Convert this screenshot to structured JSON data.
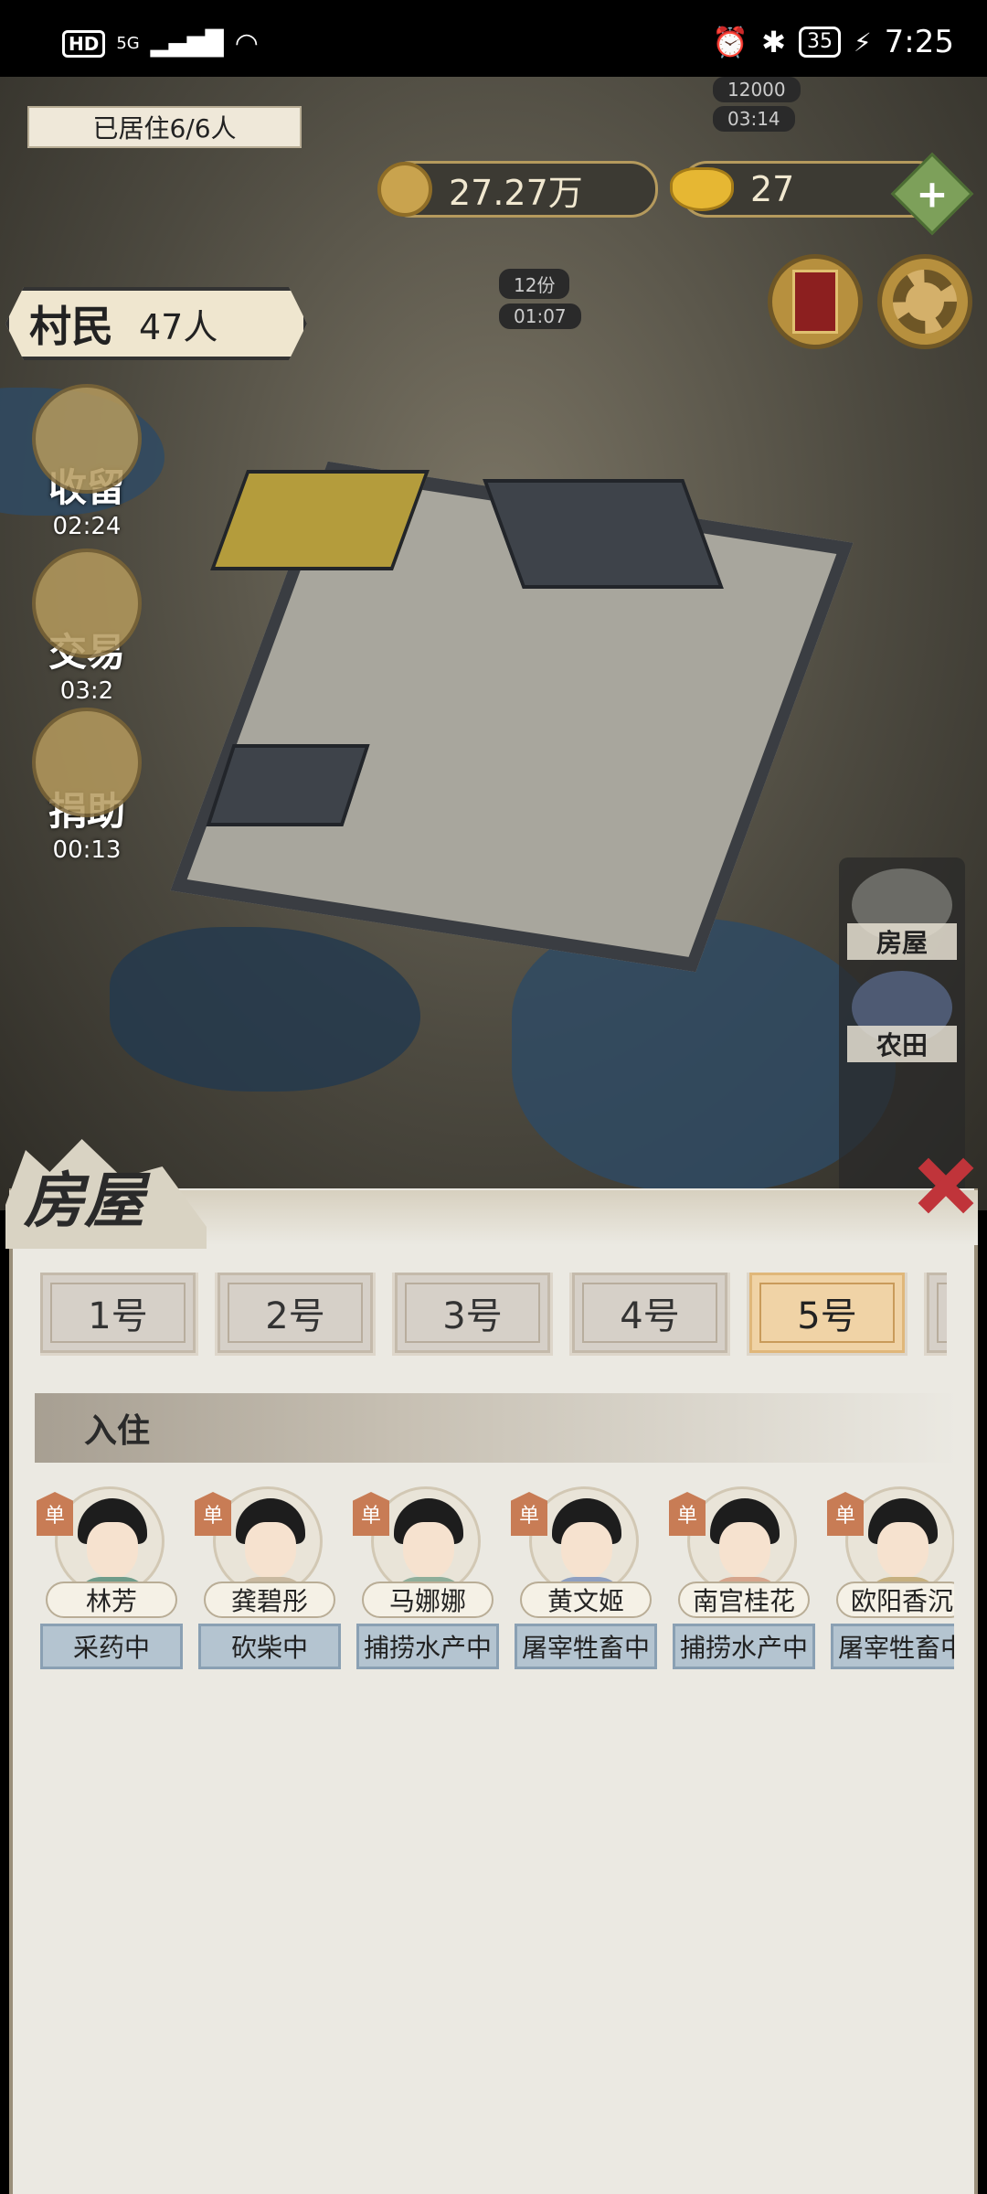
{
  "status_bar": {
    "hd": "HD",
    "network": "5G",
    "battery": "35",
    "time": "7:25"
  },
  "hud": {
    "occupancy": "已居住6/6人",
    "coins": "27.27万",
    "ingots": "27",
    "villagers_label": "村民",
    "villagers_value": "47人",
    "timers": [
      "12000",
      "03:14",
      "12份",
      "01:07"
    ]
  },
  "side_actions": [
    {
      "label": "收留",
      "time": "02:24"
    },
    {
      "label": "交易",
      "time": "03:2"
    },
    {
      "label": "捐助",
      "time": "00:13"
    }
  ],
  "category_menu": [
    "房屋",
    "农田"
  ],
  "panel": {
    "title": "房屋",
    "tabs": [
      "1号",
      "2号",
      "3号",
      "4号",
      "5号"
    ],
    "active_tab": "5号",
    "section_title": "入住",
    "residents": [
      {
        "badge": "单",
        "name": "林芳",
        "status": "采药中"
      },
      {
        "badge": "单",
        "name": "龚碧彤",
        "status": "砍柴中"
      },
      {
        "badge": "单",
        "name": "马娜娜",
        "status": "捕捞水产中"
      },
      {
        "badge": "单",
        "name": "黄文姬",
        "status": "屠宰牲畜中"
      },
      {
        "badge": "单",
        "name": "南宫桂花",
        "status": "捕捞水产中"
      },
      {
        "badge": "单",
        "name": "欧阳香沉",
        "status": "屠宰牲畜中"
      }
    ]
  },
  "colors": {
    "active_tab": "#f0d3a6",
    "status_bg": "#b4c4d0",
    "close": "#c0343a"
  },
  "icons": [
    "coin-icon",
    "ingot-icon",
    "scroll-icon",
    "gear-icon",
    "plus-icon",
    "close-icon"
  ]
}
